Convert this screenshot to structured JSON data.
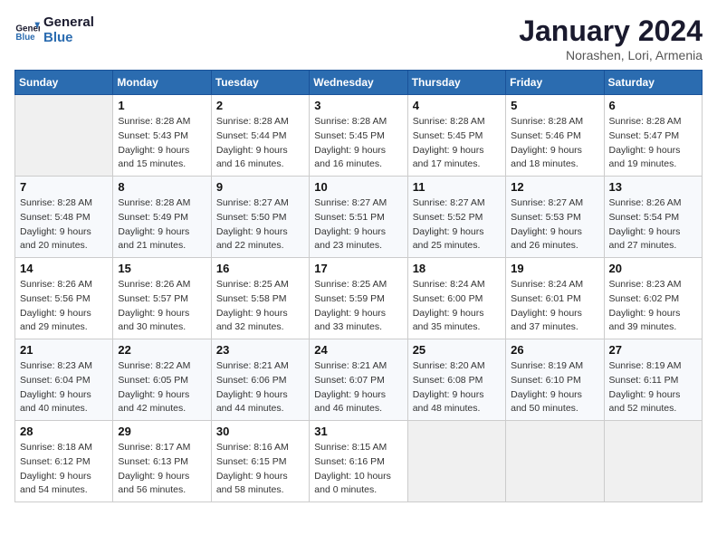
{
  "header": {
    "logo_line1": "General",
    "logo_line2": "Blue",
    "month": "January 2024",
    "location": "Norashen, Lori, Armenia"
  },
  "days_of_week": [
    "Sunday",
    "Monday",
    "Tuesday",
    "Wednesday",
    "Thursday",
    "Friday",
    "Saturday"
  ],
  "weeks": [
    [
      {
        "day": "",
        "info": ""
      },
      {
        "day": "1",
        "info": "Sunrise: 8:28 AM\nSunset: 5:43 PM\nDaylight: 9 hours\nand 15 minutes."
      },
      {
        "day": "2",
        "info": "Sunrise: 8:28 AM\nSunset: 5:44 PM\nDaylight: 9 hours\nand 16 minutes."
      },
      {
        "day": "3",
        "info": "Sunrise: 8:28 AM\nSunset: 5:45 PM\nDaylight: 9 hours\nand 16 minutes."
      },
      {
        "day": "4",
        "info": "Sunrise: 8:28 AM\nSunset: 5:45 PM\nDaylight: 9 hours\nand 17 minutes."
      },
      {
        "day": "5",
        "info": "Sunrise: 8:28 AM\nSunset: 5:46 PM\nDaylight: 9 hours\nand 18 minutes."
      },
      {
        "day": "6",
        "info": "Sunrise: 8:28 AM\nSunset: 5:47 PM\nDaylight: 9 hours\nand 19 minutes."
      }
    ],
    [
      {
        "day": "7",
        "info": "Sunrise: 8:28 AM\nSunset: 5:48 PM\nDaylight: 9 hours\nand 20 minutes."
      },
      {
        "day": "8",
        "info": "Sunrise: 8:28 AM\nSunset: 5:49 PM\nDaylight: 9 hours\nand 21 minutes."
      },
      {
        "day": "9",
        "info": "Sunrise: 8:27 AM\nSunset: 5:50 PM\nDaylight: 9 hours\nand 22 minutes."
      },
      {
        "day": "10",
        "info": "Sunrise: 8:27 AM\nSunset: 5:51 PM\nDaylight: 9 hours\nand 23 minutes."
      },
      {
        "day": "11",
        "info": "Sunrise: 8:27 AM\nSunset: 5:52 PM\nDaylight: 9 hours\nand 25 minutes."
      },
      {
        "day": "12",
        "info": "Sunrise: 8:27 AM\nSunset: 5:53 PM\nDaylight: 9 hours\nand 26 minutes."
      },
      {
        "day": "13",
        "info": "Sunrise: 8:26 AM\nSunset: 5:54 PM\nDaylight: 9 hours\nand 27 minutes."
      }
    ],
    [
      {
        "day": "14",
        "info": "Sunrise: 8:26 AM\nSunset: 5:56 PM\nDaylight: 9 hours\nand 29 minutes."
      },
      {
        "day": "15",
        "info": "Sunrise: 8:26 AM\nSunset: 5:57 PM\nDaylight: 9 hours\nand 30 minutes."
      },
      {
        "day": "16",
        "info": "Sunrise: 8:25 AM\nSunset: 5:58 PM\nDaylight: 9 hours\nand 32 minutes."
      },
      {
        "day": "17",
        "info": "Sunrise: 8:25 AM\nSunset: 5:59 PM\nDaylight: 9 hours\nand 33 minutes."
      },
      {
        "day": "18",
        "info": "Sunrise: 8:24 AM\nSunset: 6:00 PM\nDaylight: 9 hours\nand 35 minutes."
      },
      {
        "day": "19",
        "info": "Sunrise: 8:24 AM\nSunset: 6:01 PM\nDaylight: 9 hours\nand 37 minutes."
      },
      {
        "day": "20",
        "info": "Sunrise: 8:23 AM\nSunset: 6:02 PM\nDaylight: 9 hours\nand 39 minutes."
      }
    ],
    [
      {
        "day": "21",
        "info": "Sunrise: 8:23 AM\nSunset: 6:04 PM\nDaylight: 9 hours\nand 40 minutes."
      },
      {
        "day": "22",
        "info": "Sunrise: 8:22 AM\nSunset: 6:05 PM\nDaylight: 9 hours\nand 42 minutes."
      },
      {
        "day": "23",
        "info": "Sunrise: 8:21 AM\nSunset: 6:06 PM\nDaylight: 9 hours\nand 44 minutes."
      },
      {
        "day": "24",
        "info": "Sunrise: 8:21 AM\nSunset: 6:07 PM\nDaylight: 9 hours\nand 46 minutes."
      },
      {
        "day": "25",
        "info": "Sunrise: 8:20 AM\nSunset: 6:08 PM\nDaylight: 9 hours\nand 48 minutes."
      },
      {
        "day": "26",
        "info": "Sunrise: 8:19 AM\nSunset: 6:10 PM\nDaylight: 9 hours\nand 50 minutes."
      },
      {
        "day": "27",
        "info": "Sunrise: 8:19 AM\nSunset: 6:11 PM\nDaylight: 9 hours\nand 52 minutes."
      }
    ],
    [
      {
        "day": "28",
        "info": "Sunrise: 8:18 AM\nSunset: 6:12 PM\nDaylight: 9 hours\nand 54 minutes."
      },
      {
        "day": "29",
        "info": "Sunrise: 8:17 AM\nSunset: 6:13 PM\nDaylight: 9 hours\nand 56 minutes."
      },
      {
        "day": "30",
        "info": "Sunrise: 8:16 AM\nSunset: 6:15 PM\nDaylight: 9 hours\nand 58 minutes."
      },
      {
        "day": "31",
        "info": "Sunrise: 8:15 AM\nSunset: 6:16 PM\nDaylight: 10 hours\nand 0 minutes."
      },
      {
        "day": "",
        "info": ""
      },
      {
        "day": "",
        "info": ""
      },
      {
        "day": "",
        "info": ""
      }
    ]
  ]
}
